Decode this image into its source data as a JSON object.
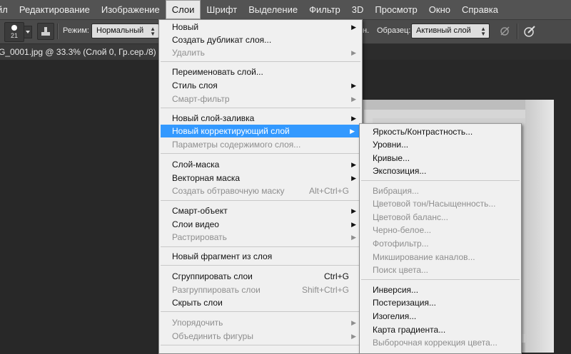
{
  "menubar": {
    "items": [
      "йл",
      "Редактирование",
      "Изображение",
      "Слои",
      "Шрифт",
      "Выделение",
      "Фильтр",
      "3D",
      "Просмотр",
      "Окно",
      "Справка"
    ],
    "active_index": 3
  },
  "options": {
    "brush_size": "21",
    "mode_label": "Режим:",
    "mode_value": "Нормальный",
    "sample_suffix": "н.",
    "sample_label": "Образец:",
    "sample_value": "Активный слой"
  },
  "document": {
    "tab_title": "G_0001.jpg @ 33.3% (Слой 0, Гр.сер./8) *"
  },
  "layer_menu": {
    "items": [
      {
        "label": "Новый",
        "disabled": false,
        "submenu": true
      },
      {
        "label": "Создать дубликат слоя...",
        "disabled": false
      },
      {
        "label": "Удалить",
        "disabled": true,
        "submenu": true
      },
      {
        "label": "Переименовать слой...",
        "disabled": false
      },
      {
        "label": "Стиль слоя",
        "disabled": false,
        "submenu": true
      },
      {
        "label": "Смарт-фильтр",
        "disabled": true,
        "submenu": true
      },
      {
        "label": "Новый слой-заливка",
        "disabled": false,
        "submenu": true
      },
      {
        "label": "Новый корректирующий слой",
        "disabled": false,
        "submenu": true,
        "highlighted": true
      },
      {
        "label": "Параметры содержимого слоя...",
        "disabled": true
      },
      {
        "label": "Слой-маска",
        "disabled": false,
        "submenu": true
      },
      {
        "label": "Векторная маска",
        "disabled": false,
        "submenu": true
      },
      {
        "label": "Создать обтравочную маску",
        "disabled": true,
        "shortcut": "Alt+Ctrl+G"
      },
      {
        "label": "Смарт-объект",
        "disabled": false,
        "submenu": true
      },
      {
        "label": "Слои видео",
        "disabled": false,
        "submenu": true
      },
      {
        "label": "Растрировать",
        "disabled": true,
        "submenu": true
      },
      {
        "label": "Новый фрагмент из слоя",
        "disabled": false
      },
      {
        "label": "Сгруппировать слои",
        "disabled": false,
        "shortcut": "Ctrl+G"
      },
      {
        "label": "Разгруппировать слои",
        "disabled": true,
        "shortcut": "Shift+Ctrl+G"
      },
      {
        "label": "Скрыть слои",
        "disabled": false
      },
      {
        "label": "Упорядочить",
        "disabled": true,
        "submenu": true
      },
      {
        "label": "Объединить фигуры",
        "disabled": true,
        "submenu": true
      }
    ]
  },
  "adjustment_menu": {
    "items": [
      {
        "label": "Яркость/Контрастность...",
        "disabled": false
      },
      {
        "label": "Уровни...",
        "disabled": false
      },
      {
        "label": "Кривые...",
        "disabled": false
      },
      {
        "label": "Экспозиция...",
        "disabled": false
      },
      {
        "label": "Вибрация...",
        "disabled": true
      },
      {
        "label": "Цветовой тон/Насыщенность...",
        "disabled": true
      },
      {
        "label": "Цветовой баланс...",
        "disabled": true
      },
      {
        "label": "Черно-белое...",
        "disabled": true
      },
      {
        "label": "Фотофильтр...",
        "disabled": true
      },
      {
        "label": "Микширование каналов...",
        "disabled": true
      },
      {
        "label": "Поиск цвета...",
        "disabled": true
      },
      {
        "label": "Инверсия...",
        "disabled": false
      },
      {
        "label": "Постеризация...",
        "disabled": false
      },
      {
        "label": "Изогелия...",
        "disabled": false
      },
      {
        "label": "Карта градиента...",
        "disabled": false
      },
      {
        "label": "Выборочная коррекция цвета...",
        "disabled": true
      }
    ]
  },
  "colors": {
    "highlight": "#3399ff",
    "menu_bg": "#f0f0f0",
    "app_bg": "#282828",
    "disabled_text": "#8e8e8e"
  }
}
